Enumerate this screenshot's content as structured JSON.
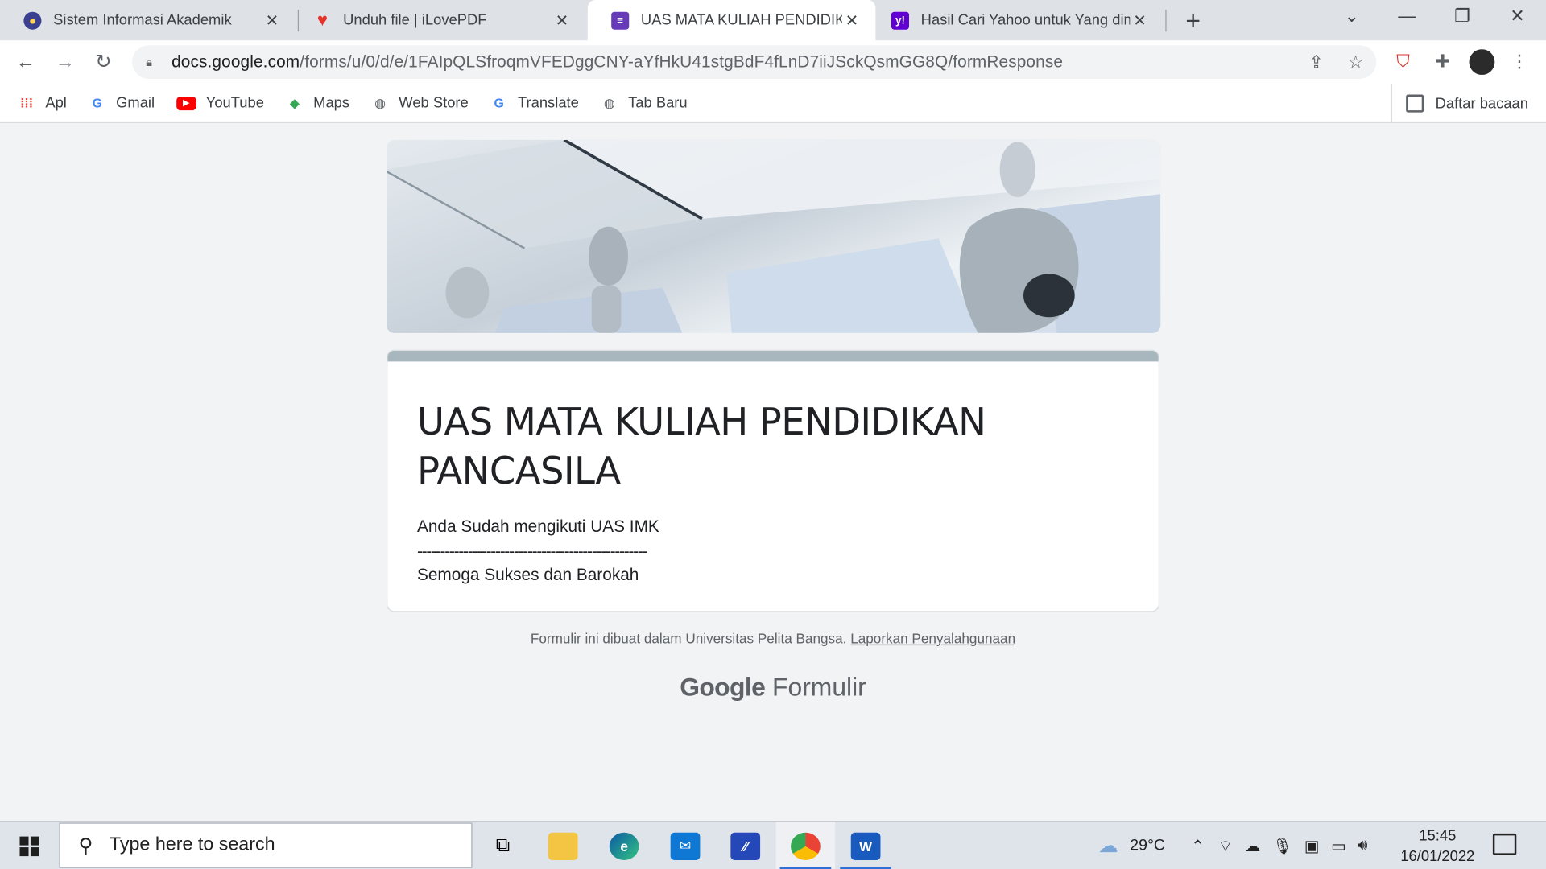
{
  "tabs": [
    {
      "title": "Sistem Informasi Akademik",
      "icon": "university-seal-icon"
    },
    {
      "title": "Unduh file | iLovePDF",
      "icon": "ilovepdf-heart-icon"
    },
    {
      "title": "UAS MATA KULIAH PENDIDIKAN",
      "icon": "google-forms-icon"
    },
    {
      "title": "Hasil Cari Yahoo untuk Yang dima",
      "icon": "yahoo-icon"
    }
  ],
  "window_controls": {
    "minimize": "—",
    "restore": "❐",
    "close": "✕",
    "tab_search": "⌄",
    "new_tab": "+"
  },
  "omnibox": {
    "domain": "docs.google.com",
    "path": "/forms/u/0/d/e/1FAIpQLSfroqmVFEDggCNY-aYfHkU41stgBdF4fLnD7iiJSckQsmGG8Q/formResponse"
  },
  "bookmarks": [
    {
      "label": "Apl",
      "icon": "apps-grid-icon"
    },
    {
      "label": "Gmail",
      "icon": "gmail-icon"
    },
    {
      "label": "YouTube",
      "icon": "youtube-icon"
    },
    {
      "label": "Maps",
      "icon": "maps-icon"
    },
    {
      "label": "Web Store",
      "icon": "web-store-icon"
    },
    {
      "label": "Translate",
      "icon": "translate-icon"
    },
    {
      "label": "Tab Baru",
      "icon": "globe-icon"
    }
  ],
  "reading_list": "Daftar bacaan",
  "form": {
    "title": "UAS MATA KULIAH PENDIDIKAN PANCASILA",
    "line1": "Anda Sudah mengikuti UAS IMK",
    "line2": "--------------------------------------------------",
    "line3": "Semoga Sukses dan Barokah"
  },
  "footer": {
    "note": "Formulir ini dibuat dalam Universitas Pelita Bangsa.",
    "report_link": "Laporkan Penyalahgunaan",
    "brand_google": "Google",
    "brand_product": "Formulir"
  },
  "taskbar": {
    "search_placeholder": "Type here to search",
    "weather_temp": "29°C",
    "time": "15:45",
    "date": "16/01/2022"
  },
  "colors": {
    "form_accent": "#a8b7be",
    "forms_purple": "#673ab7",
    "yahoo_purple": "#6001d2",
    "taskbar_active": "#2e6fd8"
  }
}
